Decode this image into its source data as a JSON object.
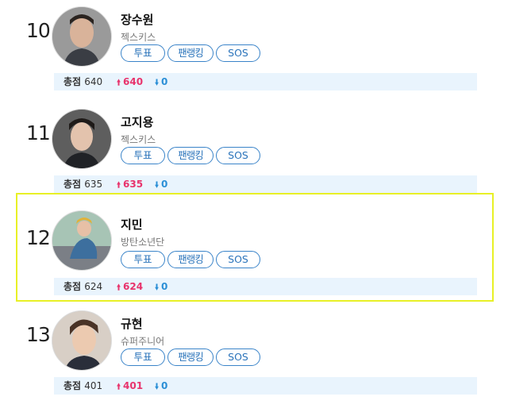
{
  "entries": [
    {
      "rank": "10",
      "name": "장수원",
      "group": "젝스키스",
      "total_label": "총점",
      "total": "640",
      "up": "640",
      "down": "0",
      "highlighted": false,
      "bg": "#8a8a8a"
    },
    {
      "rank": "11",
      "name": "고지용",
      "group": "젝스키스",
      "total_label": "총점",
      "total": "635",
      "up": "635",
      "down": "0",
      "highlighted": false,
      "bg": "#707070"
    },
    {
      "rank": "12",
      "name": "지민",
      "group": "방탄소년단",
      "total_label": "총점",
      "total": "624",
      "up": "624",
      "down": "0",
      "highlighted": true,
      "bg": "#8fb2a4"
    },
    {
      "rank": "13",
      "name": "규현",
      "group": "슈퍼주니어",
      "total_label": "총점",
      "total": "401",
      "up": "401",
      "down": "0",
      "highlighted": false,
      "bg": "#6b5a4e"
    }
  ],
  "buttons": {
    "vote": "투표",
    "fan_ranking": "팬랭킹",
    "sos": "SOS"
  },
  "icons": {
    "up": "arrow-up-icon",
    "down": "arrow-down-icon"
  },
  "colors": {
    "up": "#e8336c",
    "down": "#2b8fd6",
    "button_border": "#3a84c9",
    "highlight": "#e8f026",
    "stats_bg": "#e9f4fd"
  }
}
